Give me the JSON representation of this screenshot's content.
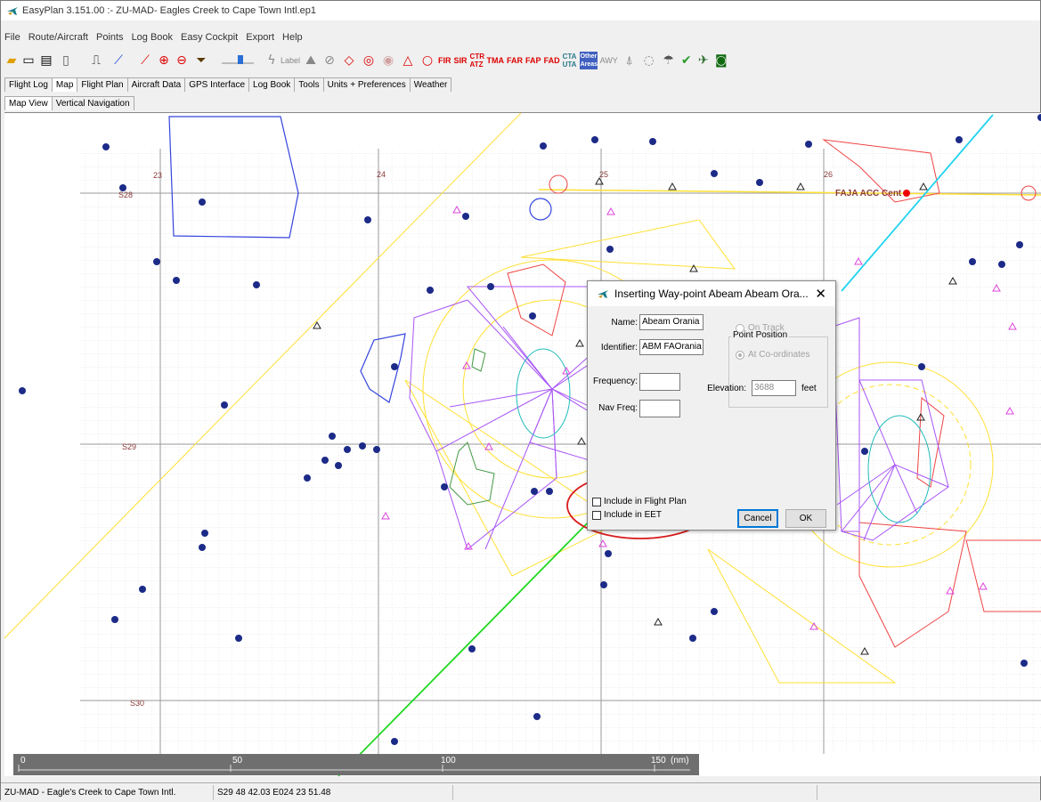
{
  "window": {
    "title": "EasyPlan 3.151.00 :- ZU-MAD- Eagles Creek to Cape Town Intl.ep1"
  },
  "menu": [
    "File",
    "Route/Aircraft",
    "Points",
    "Log Book",
    "Easy Cockpit",
    "Export",
    "Help"
  ],
  "toolbar": {
    "label_text": "Label",
    "text_buttons": [
      "FIR",
      "SIR",
      "CTR ATZ",
      "TMA",
      "FAR",
      "FAP",
      "FAD",
      "CTA UTA",
      "Other Areas",
      "AWY"
    ]
  },
  "main_tabs": [
    "Flight Log",
    "Map",
    "Flight Plan",
    "Aircraft Data",
    "GPS Interface",
    "Log Book",
    "Tools",
    "Units + Preferences",
    "Weather"
  ],
  "main_tabs_active": "Map",
  "sub_tabs": [
    "Map View",
    "Vertical Navigation"
  ],
  "sub_tabs_active": "Map View",
  "map": {
    "lon_labels": [
      "23",
      "24",
      "25",
      "26"
    ],
    "lat_labels": [
      "S28",
      "S29",
      "S30"
    ],
    "station_label": "FAJA ACC Cent",
    "scale": {
      "ticks": [
        "0",
        "50",
        "100",
        "150"
      ],
      "unit": "(nm)"
    }
  },
  "dialog": {
    "title": "Inserting Way-point Abeam Abeam Ora...",
    "name_label": "Name:",
    "name_value": "Abeam Orania",
    "identifier_label": "Identifier:",
    "identifier_value": "ABM FAOrania",
    "frequency_label": "Frequency:",
    "frequency_value": "",
    "navfreq_label": "Nav Freq:",
    "navfreq_value": "",
    "point_position_title": "Point Position",
    "radio_on_track": "On Track",
    "radio_at_coords": "At Co-ordinates",
    "elevation_label": "Elevation:",
    "elevation_value": "3688",
    "elevation_unit": "feet",
    "check_flight_plan": "Include in Flight Plan",
    "check_eet": "Include in EET",
    "cancel": "Cancel",
    "ok": "OK"
  },
  "status": {
    "route": "ZU-MAD - Eagle's Creek to Cape Town Intl.",
    "position": "S29 48 42.03  E024 23 51.48"
  },
  "colors": {
    "highlight_circle": "#d81b1b",
    "route_green": "#22d822",
    "airway_cyan": "#22d3f0",
    "area_yellow": "#ffee55",
    "area_purple": "#a44ff0",
    "area_red": "#ef3e3e"
  }
}
